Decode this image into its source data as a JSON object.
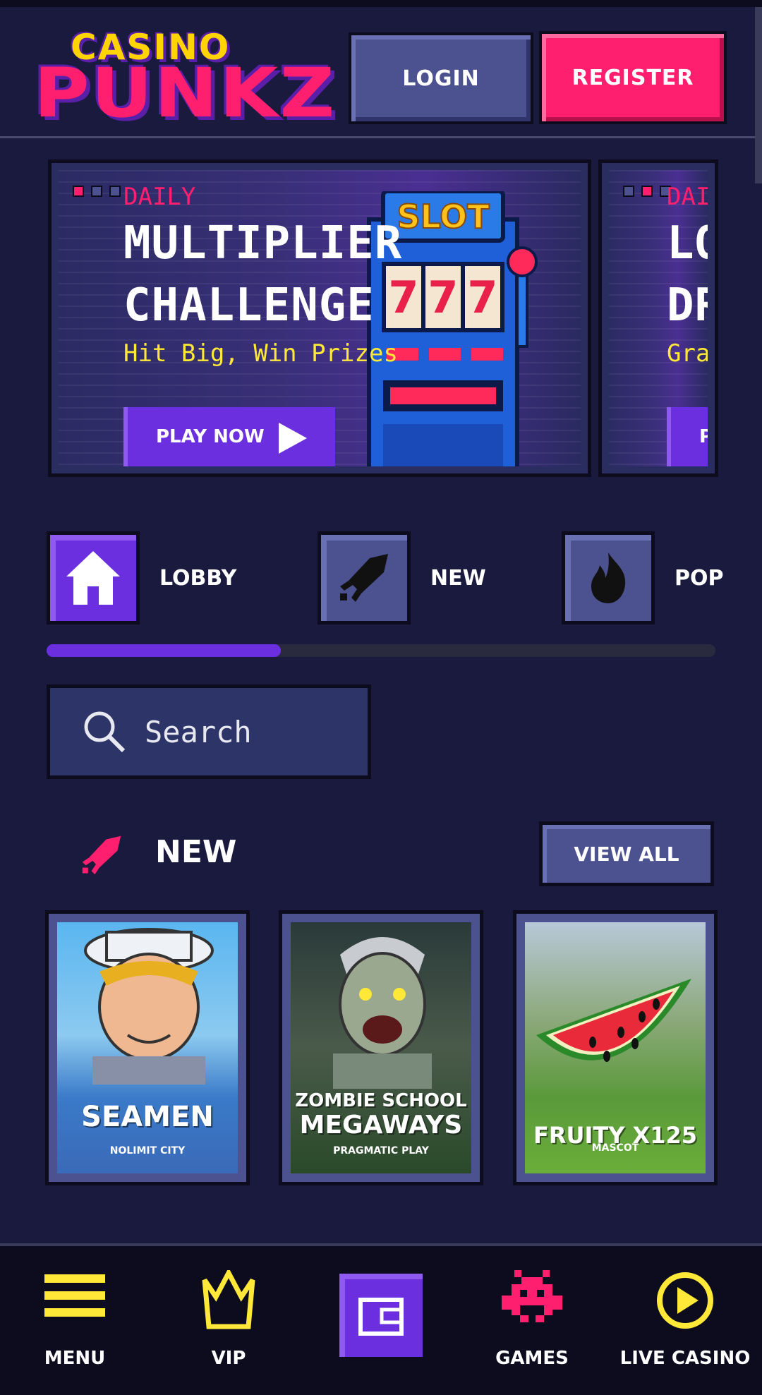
{
  "header": {
    "logo_top": "CASINO",
    "logo_bottom": "PUNKZ",
    "login_label": "LOGIN",
    "register_label": "REGISTER"
  },
  "banners": [
    {
      "tag": "DAILY",
      "title_line1": "MULTIPLIER",
      "title_line2": "CHALLENGE",
      "subtitle": "Hit Big, Win Prizes",
      "cta": "PLAY NOW"
    },
    {
      "tag": "DAIL",
      "title_line1": "LO",
      "title_line2": "DR",
      "subtitle": "Grab",
      "cta": "PL"
    }
  ],
  "categories": [
    {
      "label": "LOBBY",
      "icon": "house-icon",
      "active": true
    },
    {
      "label": "NEW",
      "icon": "rocket-icon",
      "active": false
    },
    {
      "label": "POP",
      "icon": "flame-icon",
      "active": false
    }
  ],
  "category_scroll_progress": 0.35,
  "search": {
    "placeholder": "Search"
  },
  "section": {
    "title": "NEW",
    "icon": "rocket-icon",
    "view_all": "VIEW ALL"
  },
  "games": [
    {
      "title": "SEAMEN",
      "provider": "NOLIMIT CITY"
    },
    {
      "title_line1": "ZOMBIE SCHOOL",
      "title_line2": "MEGAWAYS",
      "provider": "PRAGMATIC PLAY"
    },
    {
      "title": "FRUITY X125",
      "provider": "MASCOT"
    }
  ],
  "bottom_nav": [
    {
      "label": "MENU",
      "icon": "menu-icon"
    },
    {
      "label": "VIP",
      "icon": "crown-icon"
    },
    {
      "label": "",
      "icon": "wallet-icon"
    },
    {
      "label": "GAMES",
      "icon": "space-invader-icon",
      "active": true
    },
    {
      "label": "LIVE CASINO",
      "icon": "play-circle-icon"
    }
  ],
  "colors": {
    "background": "#1a1a3e",
    "accent_pink": "#ff1f6e",
    "accent_purple": "#6b2fe0",
    "accent_yellow": "#ffe838",
    "button_grey": "#4c5190"
  }
}
